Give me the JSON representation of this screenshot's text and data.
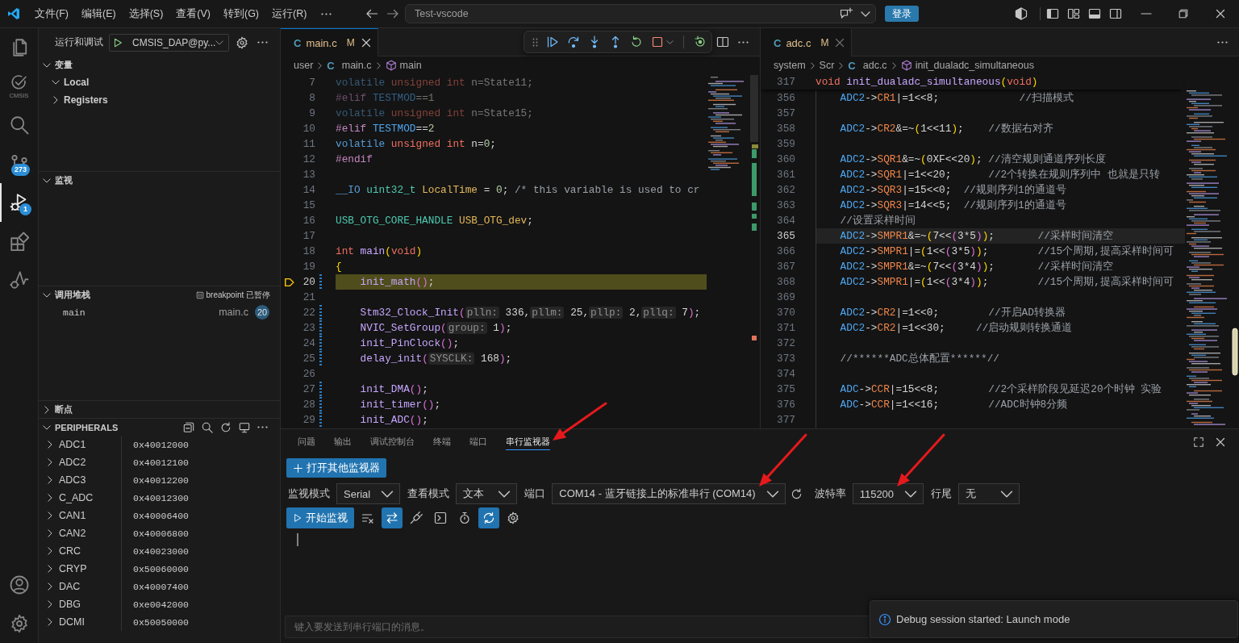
{
  "title_bar": {
    "menus": [
      "文件(F)",
      "编辑(E)",
      "选择(S)",
      "查看(V)",
      "转到(G)",
      "运行(R)"
    ],
    "command_center": "Test-vscode",
    "login_button": "登录"
  },
  "activity_bar": {
    "items": [
      {
        "kind": "explorer",
        "selected": false
      },
      {
        "kind": "cmsis",
        "label": "CMSIS",
        "selected": false
      },
      {
        "kind": "search",
        "selected": false
      },
      {
        "kind": "source_control",
        "badge": "273",
        "selected": false
      },
      {
        "kind": "run_debug",
        "badge": "1",
        "selected": true
      },
      {
        "kind": "extensions",
        "selected": false
      },
      {
        "kind": "debug_graph",
        "selected": false
      }
    ],
    "bottom_items": [
      {
        "kind": "account"
      },
      {
        "kind": "settings"
      }
    ]
  },
  "sidebar": {
    "title": "运行和调试",
    "launch_config": "CMSIS_DAP@py...",
    "sections": [
      {
        "kind": "variables",
        "title": "变量",
        "expanded": true,
        "items": [
          {
            "label": "Local",
            "expanded": true
          },
          {
            "label": "Registers",
            "expanded": false
          }
        ]
      },
      {
        "kind": "watch",
        "title": "监视",
        "expanded": true
      },
      {
        "kind": "call_stack",
        "title": "调用堆栈",
        "expanded": true,
        "status": "breakpoint 已暂停",
        "frames": [
          {
            "name": "main",
            "file": "main.c",
            "line": "20"
          }
        ]
      },
      {
        "kind": "breakpoints",
        "title": "断点",
        "expanded": false
      },
      {
        "kind": "peripherals",
        "title": "PERIPHERALS",
        "expanded": true,
        "rows": [
          {
            "name": "ADC1",
            "address": "0x40012000",
            "expanded": false
          },
          {
            "name": "ADC2",
            "address": "0x40012100",
            "expanded": false
          },
          {
            "name": "ADC3",
            "address": "0x40012200",
            "expanded": false
          },
          {
            "name": "C_ADC",
            "address": "0x40012300",
            "expanded": false
          },
          {
            "name": "CAN1",
            "address": "0x40006400",
            "expanded": false
          },
          {
            "name": "CAN2",
            "address": "0x40006800",
            "expanded": false
          },
          {
            "name": "CRC",
            "address": "0x40023000",
            "expanded": false
          },
          {
            "name": "CRYP",
            "address": "0x50060000",
            "expanded": false
          },
          {
            "name": "DAC",
            "address": "0x40007400",
            "expanded": false
          },
          {
            "name": "DBG",
            "address": "0xe0042000",
            "expanded": false
          },
          {
            "name": "DCMI",
            "address": "0x50050000",
            "expanded": false
          }
        ]
      }
    ]
  },
  "editors": [
    {
      "active": true,
      "tabs": [
        {
          "file_icon": "C",
          "label": "main.c",
          "status": "M",
          "selected": true
        }
      ],
      "debug_toolbar": [
        {
          "kind": "grip"
        },
        {
          "kind": "continue"
        },
        {
          "kind": "step_over"
        },
        {
          "kind": "step_into"
        },
        {
          "kind": "step_out"
        },
        {
          "kind": "restart"
        },
        {
          "kind": "stop"
        },
        {
          "kind": "dropdown"
        },
        {
          "kind": "separator"
        },
        {
          "kind": "restart_frame"
        }
      ],
      "actions": [
        {
          "kind": "split"
        },
        {
          "kind": "more"
        }
      ],
      "breadcrumb": [
        {
          "kind": "folder",
          "label": "user"
        },
        {
          "kind": "file",
          "file_icon": "C",
          "label": "main.c"
        },
        {
          "kind": "function",
          "label": "main"
        }
      ],
      "lines": [
        {
          "number": "7",
          "inactive": true,
          "modified": false,
          "paused": false,
          "tokens": [
            {
              "kind": "kw",
              "text": "volatile"
            },
            {
              "kind": "type",
              "text": " unsigned"
            },
            {
              "kind": "type",
              "text": " int"
            },
            {
              "kind": "txt",
              "text": " n=State11;"
            }
          ]
        },
        {
          "number": "8",
          "inactive": true,
          "modified": false,
          "paused": false,
          "tokens": [
            {
              "kind": "pp",
              "text": "#elif"
            },
            {
              "kind": "macro",
              "text": " TESTMOD"
            },
            {
              "kind": "txt",
              "text": "=="
            },
            {
              "kind": "num",
              "text": "1"
            }
          ]
        },
        {
          "number": "9",
          "inactive": true,
          "modified": false,
          "paused": false,
          "tokens": [
            {
              "kind": "kw",
              "text": "volatile"
            },
            {
              "kind": "type",
              "text": " unsigned"
            },
            {
              "kind": "type",
              "text": " int"
            },
            {
              "kind": "txt",
              "text": " n=State15;"
            }
          ]
        },
        {
          "number": "10",
          "inactive": false,
          "modified": false,
          "paused": false,
          "tokens": [
            {
              "kind": "pp",
              "text": "#elif"
            },
            {
              "kind": "macro",
              "text": " TESTMOD"
            },
            {
              "kind": "txt",
              "text": "=="
            },
            {
              "kind": "num",
              "text": "2"
            }
          ]
        },
        {
          "number": "11",
          "inactive": false,
          "modified": false,
          "paused": false,
          "tokens": [
            {
              "kind": "kw",
              "text": "volatile"
            },
            {
              "kind": "type",
              "text": " unsigned"
            },
            {
              "kind": "type",
              "text": " int"
            },
            {
              "kind": "txt",
              "text": " n="
            },
            {
              "kind": "num",
              "text": "0"
            },
            {
              "kind": "txt",
              "text": ";"
            }
          ]
        },
        {
          "number": "12",
          "inactive": false,
          "modified": false,
          "paused": false,
          "tokens": [
            {
              "kind": "pp",
              "text": "#endif"
            }
          ]
        },
        {
          "number": "13",
          "modified": false,
          "paused": false
        },
        {
          "number": "14",
          "inactive": false,
          "modified": false,
          "paused": false,
          "tokens": [
            {
              "kind": "kw",
              "text": "__IO"
            },
            {
              "kind": "struct",
              "text": " uint32_t"
            },
            {
              "kind": "var",
              "text": " LocalTime"
            },
            {
              "kind": "txt",
              "text": " = "
            },
            {
              "kind": "num",
              "text": "0"
            },
            {
              "kind": "txt",
              "text": ";"
            },
            {
              "kind": "cmt",
              "text": " /* this variable is used to cr"
            }
          ]
        },
        {
          "number": "15",
          "modified": false,
          "paused": false
        },
        {
          "number": "16",
          "inactive": false,
          "modified": false,
          "paused": false,
          "tokens": [
            {
              "kind": "struct",
              "text": "USB_OTG_CORE_HANDLE"
            },
            {
              "kind": "var",
              "text": " USB_OTG_dev"
            },
            {
              "kind": "txt",
              "text": ";"
            }
          ]
        },
        {
          "number": "17",
          "modified": false,
          "paused": false
        },
        {
          "number": "18",
          "inactive": false,
          "modified": false,
          "paused": false,
          "tokens": [
            {
              "kind": "type",
              "text": "int"
            },
            {
              "kind": "fn",
              "text": " main"
            },
            {
              "kind": "br1",
              "text": "("
            },
            {
              "kind": "type",
              "text": "void"
            },
            {
              "kind": "br1",
              "text": ")"
            }
          ]
        },
        {
          "number": "19",
          "inactive": false,
          "modified": false,
          "paused": false,
          "tokens": [
            {
              "kind": "br1",
              "text": "{"
            }
          ]
        },
        {
          "number": "20",
          "inactive": false,
          "modified": true,
          "paused": true,
          "tokens": [
            {
              "kind": "fn",
              "text": "    init_math"
            },
            {
              "kind": "br2",
              "text": "()"
            },
            {
              "kind": "txt",
              "text": ";"
            }
          ]
        },
        {
          "number": "21",
          "modified": false,
          "paused": false
        },
        {
          "number": "22",
          "inactive": false,
          "modified": true,
          "paused": false,
          "tokens": [
            {
              "kind": "fn",
              "text": "    Stm32_Clock_Init"
            },
            {
              "kind": "br2",
              "text": "("
            },
            {
              "kind": "hint",
              "text": "plln:"
            },
            {
              "kind": "txt",
              "text": " 336,"
            },
            {
              "kind": "hint",
              "text": "pllm:"
            },
            {
              "kind": "txt",
              "text": " 25,"
            },
            {
              "kind": "hint",
              "text": "pllp:"
            },
            {
              "kind": "txt",
              "text": " 2,"
            },
            {
              "kind": "hint",
              "text": "pllq:"
            },
            {
              "kind": "txt",
              "text": " 7"
            },
            {
              "kind": "br2",
              "text": ")"
            },
            {
              "kind": "txt",
              "text": ";"
            }
          ]
        },
        {
          "number": "23",
          "inactive": false,
          "modified": true,
          "paused": false,
          "tokens": [
            {
              "kind": "fn",
              "text": "    NVIC_SetGroup"
            },
            {
              "kind": "br2",
              "text": "("
            },
            {
              "kind": "hint",
              "text": "group:"
            },
            {
              "kind": "txt",
              "text": " 1"
            },
            {
              "kind": "br2",
              "text": ")"
            },
            {
              "kind": "txt",
              "text": ";"
            }
          ]
        },
        {
          "number": "24",
          "inactive": false,
          "modified": true,
          "paused": false,
          "tokens": [
            {
              "kind": "fn",
              "text": "    init_PinClock"
            },
            {
              "kind": "br2",
              "text": "()"
            },
            {
              "kind": "txt",
              "text": ";"
            }
          ]
        },
        {
          "number": "25",
          "inactive": false,
          "modified": true,
          "paused": false,
          "tokens": [
            {
              "kind": "fn",
              "text": "    delay_init"
            },
            {
              "kind": "br2",
              "text": "("
            },
            {
              "kind": "hint",
              "text": "SYSCLK:"
            },
            {
              "kind": "txt",
              "text": " 168"
            },
            {
              "kind": "br2",
              "text": ")"
            },
            {
              "kind": "txt",
              "text": ";"
            }
          ]
        },
        {
          "number": "26",
          "modified": false,
          "paused": false
        },
        {
          "number": "27",
          "inactive": false,
          "modified": true,
          "paused": false,
          "tokens": [
            {
              "kind": "fn",
              "text": "    init_DMA"
            },
            {
              "kind": "br2",
              "text": "()"
            },
            {
              "kind": "txt",
              "text": ";"
            }
          ]
        },
        {
          "number": "28",
          "inactive": false,
          "modified": true,
          "paused": false,
          "tokens": [
            {
              "kind": "fn",
              "text": "    init_timer"
            },
            {
              "kind": "br2",
              "text": "()"
            },
            {
              "kind": "txt",
              "text": ";"
            }
          ]
        },
        {
          "number": "29",
          "inactive": false,
          "modified": true,
          "paused": false,
          "tokens": [
            {
              "kind": "fn",
              "text": "    init_ADC"
            },
            {
              "kind": "br2",
              "text": "()"
            },
            {
              "kind": "txt",
              "text": ";"
            }
          ]
        }
      ]
    },
    {
      "active": false,
      "tabs": [
        {
          "file_icon": "C",
          "label": "adc.c",
          "status": "M",
          "selected": true
        }
      ],
      "actions": [
        {
          "kind": "more"
        }
      ],
      "breadcrumb": [
        {
          "kind": "folder",
          "label": "system"
        },
        {
          "kind": "folder",
          "label": "Scr"
        },
        {
          "kind": "file",
          "file_icon": "C",
          "label": "adc.c"
        },
        {
          "kind": "function",
          "label": "init_dualadc_simultaneous"
        }
      ],
      "sticky_line": {
        "number": "317",
        "tokens": [
          {
            "kind": "type",
            "text": "void"
          },
          {
            "kind": "fn",
            "text": " init_dualadc_simultaneous"
          },
          {
            "kind": "br1",
            "text": "("
          },
          {
            "kind": "type",
            "text": "void"
          },
          {
            "kind": "br1",
            "text": ")"
          }
        ]
      },
      "lines": [
        {
          "number": "356",
          "highlighted": false,
          "tokens": [
            {
              "kind": "macro",
              "text": "    ADC2"
            },
            {
              "kind": "txt",
              "text": "->"
            },
            {
              "kind": "field",
              "text": "CR1"
            },
            {
              "kind": "txt",
              "text": "|=1<<8;"
            },
            {
              "kind": "cmt",
              "text": "             //扫描模式"
            }
          ]
        },
        {
          "number": "357",
          "highlighted": false
        },
        {
          "number": "358",
          "highlighted": false,
          "tokens": [
            {
              "kind": "macro",
              "text": "    ADC2"
            },
            {
              "kind": "txt",
              "text": "->"
            },
            {
              "kind": "field",
              "text": "CR2"
            },
            {
              "kind": "txt",
              "text": "&=~"
            },
            {
              "kind": "br1",
              "text": "("
            },
            {
              "kind": "txt",
              "text": "1<<11"
            },
            {
              "kind": "br1",
              "text": ")"
            },
            {
              "kind": "txt",
              "text": ";"
            },
            {
              "kind": "cmt",
              "text": "    //数据右对齐"
            }
          ]
        },
        {
          "number": "359",
          "highlighted": false
        },
        {
          "number": "360",
          "highlighted": false,
          "tokens": [
            {
              "kind": "macro",
              "text": "    ADC2"
            },
            {
              "kind": "txt",
              "text": "->"
            },
            {
              "kind": "field",
              "text": "SQR1"
            },
            {
              "kind": "txt",
              "text": "&=~"
            },
            {
              "kind": "br1",
              "text": "("
            },
            {
              "kind": "txt",
              "text": "0XF<<20"
            },
            {
              "kind": "br1",
              "text": ")"
            },
            {
              "kind": "txt",
              "text": ";"
            },
            {
              "kind": "cmt",
              "text": " //清空规则通道序列长度"
            }
          ]
        },
        {
          "number": "361",
          "highlighted": false,
          "tokens": [
            {
              "kind": "macro",
              "text": "    ADC2"
            },
            {
              "kind": "txt",
              "text": "->"
            },
            {
              "kind": "field",
              "text": "SQR1"
            },
            {
              "kind": "txt",
              "text": "|=1<<20;"
            },
            {
              "kind": "cmt",
              "text": "      //2个转换在规则序列中 也就是只转"
            }
          ]
        },
        {
          "number": "362",
          "highlighted": false,
          "tokens": [
            {
              "kind": "macro",
              "text": "    ADC2"
            },
            {
              "kind": "txt",
              "text": "->"
            },
            {
              "kind": "field",
              "text": "SQR3"
            },
            {
              "kind": "txt",
              "text": "|=15<<0;"
            },
            {
              "kind": "cmt",
              "text": "  //规则序列1的通道号"
            }
          ]
        },
        {
          "number": "363",
          "highlighted": false,
          "tokens": [
            {
              "kind": "macro",
              "text": "    ADC2"
            },
            {
              "kind": "txt",
              "text": "->"
            },
            {
              "kind": "field",
              "text": "SQR3"
            },
            {
              "kind": "txt",
              "text": "|=14<<5;"
            },
            {
              "kind": "cmt",
              "text": "  //规则序列1的通道号"
            }
          ]
        },
        {
          "number": "364",
          "highlighted": false,
          "tokens": [
            {
              "kind": "cmt",
              "text": "    //设置采样时间"
            }
          ]
        },
        {
          "number": "365",
          "highlighted": true,
          "tokens": [
            {
              "kind": "macro",
              "text": "    ADC2"
            },
            {
              "kind": "txt",
              "text": "->"
            },
            {
              "kind": "field",
              "text": "SMPR1"
            },
            {
              "kind": "txt",
              "text": "&=~"
            },
            {
              "kind": "br1",
              "text": "("
            },
            {
              "kind": "txt",
              "text": "7<<"
            },
            {
              "kind": "br2",
              "text": "("
            },
            {
              "kind": "txt",
              "text": "3*5"
            },
            {
              "kind": "br2",
              "text": ")"
            },
            {
              "kind": "br1",
              "text": ")"
            },
            {
              "kind": "txt",
              "text": ";"
            },
            {
              "kind": "cmt",
              "text": "       //采样时间清空"
            }
          ]
        },
        {
          "number": "366",
          "highlighted": false,
          "tokens": [
            {
              "kind": "macro",
              "text": "    ADC2"
            },
            {
              "kind": "txt",
              "text": "->"
            },
            {
              "kind": "field",
              "text": "SMPR1"
            },
            {
              "kind": "txt",
              "text": "|="
            },
            {
              "kind": "br1",
              "text": "("
            },
            {
              "kind": "txt",
              "text": "1<<"
            },
            {
              "kind": "br2",
              "text": "("
            },
            {
              "kind": "txt",
              "text": "3*5"
            },
            {
              "kind": "br2",
              "text": ")"
            },
            {
              "kind": "br1",
              "text": ")"
            },
            {
              "kind": "txt",
              "text": ";"
            },
            {
              "kind": "cmt",
              "text": "        //15个周期,提高采样时间可"
            }
          ]
        },
        {
          "number": "367",
          "highlighted": false,
          "tokens": [
            {
              "kind": "macro",
              "text": "    ADC2"
            },
            {
              "kind": "txt",
              "text": "->"
            },
            {
              "kind": "field",
              "text": "SMPR1"
            },
            {
              "kind": "txt",
              "text": "&=~"
            },
            {
              "kind": "br1",
              "text": "("
            },
            {
              "kind": "txt",
              "text": "7<<"
            },
            {
              "kind": "br2",
              "text": "("
            },
            {
              "kind": "txt",
              "text": "3*4"
            },
            {
              "kind": "br2",
              "text": ")"
            },
            {
              "kind": "br1",
              "text": ")"
            },
            {
              "kind": "txt",
              "text": ";"
            },
            {
              "kind": "cmt",
              "text": "       //采样时间清空"
            }
          ]
        },
        {
          "number": "368",
          "highlighted": false,
          "tokens": [
            {
              "kind": "macro",
              "text": "    ADC2"
            },
            {
              "kind": "txt",
              "text": "->"
            },
            {
              "kind": "field",
              "text": "SMPR1"
            },
            {
              "kind": "txt",
              "text": "|="
            },
            {
              "kind": "br1",
              "text": "("
            },
            {
              "kind": "txt",
              "text": "1<<"
            },
            {
              "kind": "br2",
              "text": "("
            },
            {
              "kind": "txt",
              "text": "3*4"
            },
            {
              "kind": "br2",
              "text": ")"
            },
            {
              "kind": "br1",
              "text": ")"
            },
            {
              "kind": "txt",
              "text": ";"
            },
            {
              "kind": "cmt",
              "text": "        //15个周期,提高采样时间可"
            }
          ]
        },
        {
          "number": "369",
          "highlighted": false
        },
        {
          "number": "370",
          "highlighted": false,
          "tokens": [
            {
              "kind": "macro",
              "text": "    ADC2"
            },
            {
              "kind": "txt",
              "text": "->"
            },
            {
              "kind": "field",
              "text": "CR2"
            },
            {
              "kind": "txt",
              "text": "|=1<<0;"
            },
            {
              "kind": "cmt",
              "text": "        //开启AD转换器"
            }
          ]
        },
        {
          "number": "371",
          "highlighted": false,
          "tokens": [
            {
              "kind": "macro",
              "text": "    ADC2"
            },
            {
              "kind": "txt",
              "text": "->"
            },
            {
              "kind": "field",
              "text": "CR2"
            },
            {
              "kind": "txt",
              "text": "|=1<<30;"
            },
            {
              "kind": "cmt",
              "text": "     //启动规则转换通道"
            }
          ]
        },
        {
          "number": "372",
          "highlighted": false
        },
        {
          "number": "373",
          "highlighted": false,
          "tokens": [
            {
              "kind": "cmt",
              "text": "    //******ADC总体配置******//"
            }
          ]
        },
        {
          "number": "374",
          "highlighted": false
        },
        {
          "number": "375",
          "highlighted": false,
          "tokens": [
            {
              "kind": "macro",
              "text": "    ADC"
            },
            {
              "kind": "txt",
              "text": "->"
            },
            {
              "kind": "field",
              "text": "CCR"
            },
            {
              "kind": "txt",
              "text": "|=15<<8;"
            },
            {
              "kind": "cmt",
              "text": "        //2个采样阶段见延迟20个时钟 实验"
            }
          ]
        },
        {
          "number": "376",
          "highlighted": false,
          "tokens": [
            {
              "kind": "macro",
              "text": "    ADC"
            },
            {
              "kind": "txt",
              "text": "->"
            },
            {
              "kind": "field",
              "text": "CCR"
            },
            {
              "kind": "txt",
              "text": "|=1<<16;"
            },
            {
              "kind": "cmt",
              "text": "        //ADC时钟8分频"
            }
          ]
        },
        {
          "number": "377",
          "highlighted": false
        }
      ]
    }
  ],
  "panel": {
    "tabs": [
      {
        "label": "问题",
        "selected": false
      },
      {
        "label": "输出",
        "selected": false
      },
      {
        "label": "调试控制台",
        "selected": false
      },
      {
        "label": "终端",
        "selected": false
      },
      {
        "label": "端口",
        "selected": false
      },
      {
        "label": "串行监视器",
        "selected": true,
        "arrow": true
      }
    ],
    "open_monitor_button": "打开其他监视器",
    "settings": [
      {
        "label": "监视模式",
        "value": "Serial"
      },
      {
        "label": "查看模式",
        "value": "文本"
      },
      {
        "label": "端口",
        "value": "COM14 - 蓝牙链接上的标准串行 (COM14)",
        "refresh": true,
        "arrow": true
      },
      {
        "label": "波特率",
        "value": "115200",
        "arrow": true
      },
      {
        "label": "行尾",
        "value": "无"
      }
    ],
    "start_button": "开始监视",
    "tools": [
      {
        "kind": "clear",
        "on": false
      },
      {
        "kind": "swap",
        "on": true
      },
      {
        "kind": "plug",
        "on": false
      },
      {
        "kind": "terminal",
        "on": false
      },
      {
        "kind": "stopwatch",
        "on": false
      },
      {
        "kind": "sync",
        "on": true
      },
      {
        "kind": "settings",
        "on": false
      }
    ],
    "message_input": {
      "placeholder": "键入要发送到串行端口的消息。"
    }
  },
  "notification": {
    "kind": "info",
    "message": "Debug session started: Launch mode"
  }
}
